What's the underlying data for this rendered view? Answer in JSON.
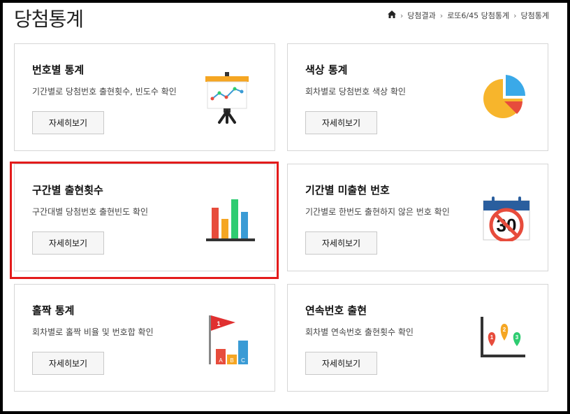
{
  "page": {
    "title": "당첨통계"
  },
  "breadcrumb": {
    "items": [
      "당첨결과",
      "로또6/45 당첨통계",
      "당첨통계"
    ]
  },
  "cards": [
    {
      "title": "번호별 통계",
      "desc": "기간별로 당첨번호 출현횟수, 빈도수 확인",
      "button": "자세히보기"
    },
    {
      "title": "색상 통계",
      "desc": "회차별로 당첨번호 색상 확인",
      "button": "자세히보기"
    },
    {
      "title": "구간별 출현횟수",
      "desc": "구간대별 당첨번호 출현빈도 확인",
      "button": "자세히보기"
    },
    {
      "title": "기간별 미출현 번호",
      "desc": "기간별로 한번도 출현하지 않은 번호 확인",
      "button": "자세히보기"
    },
    {
      "title": "홀짝 통계",
      "desc": "회차별로 홀짝 비율 및 번호합 확인",
      "button": "자세히보기"
    },
    {
      "title": "연속번호 출현",
      "desc": "회차별 연속번호 출현횟수 확인",
      "button": "자세히보기"
    }
  ],
  "icons": {
    "calendar_number": "30",
    "flag_number": "1",
    "bar_letters": [
      "A",
      "B",
      "C"
    ],
    "pin_numbers": [
      "1",
      "2",
      "3"
    ]
  }
}
